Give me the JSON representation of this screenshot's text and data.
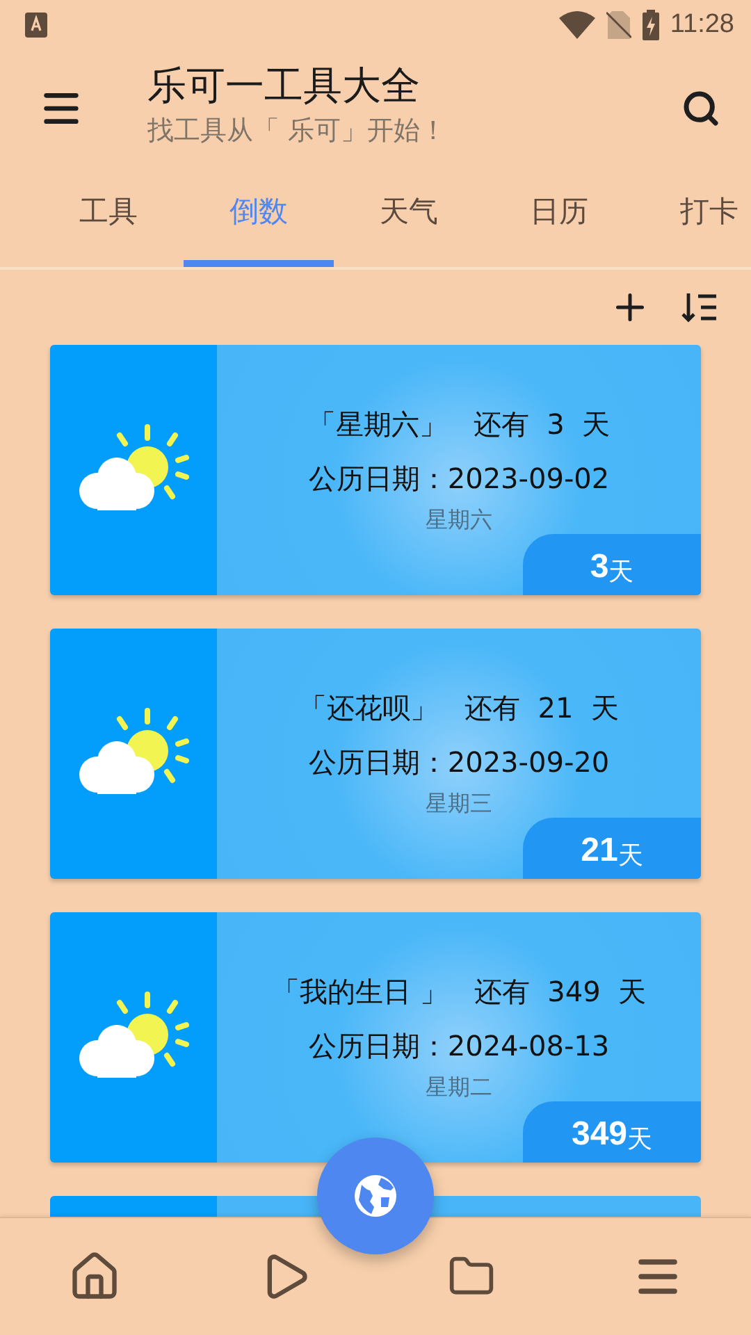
{
  "status_bar": {
    "time": "11:28"
  },
  "app_bar": {
    "title": "乐可一工具大全",
    "subtitle": "找工具从「 乐可」开始！"
  },
  "tabs": [
    {
      "label": "工具",
      "selected": false
    },
    {
      "label": "倒数",
      "selected": true
    },
    {
      "label": "天气",
      "selected": false
    },
    {
      "label": "日历",
      "selected": false
    },
    {
      "label": "打卡",
      "selected": false
    }
  ],
  "countdowns": [
    {
      "title": "「星期六」",
      "remaining": "还有  3  天",
      "date": "公历日期：2023-09-02",
      "weekday": "星期六",
      "days": "3",
      "unit": "天"
    },
    {
      "title": "「还花呗」",
      "remaining": "还有  21  天",
      "date": "公历日期：2023-09-20",
      "weekday": "星期三",
      "days": "21",
      "unit": "天"
    },
    {
      "title": "「我的生日 」",
      "remaining": "还有  349  天",
      "date": "公历日期：2024-08-13",
      "weekday": "星期二",
      "days": "349",
      "unit": "天"
    }
  ]
}
